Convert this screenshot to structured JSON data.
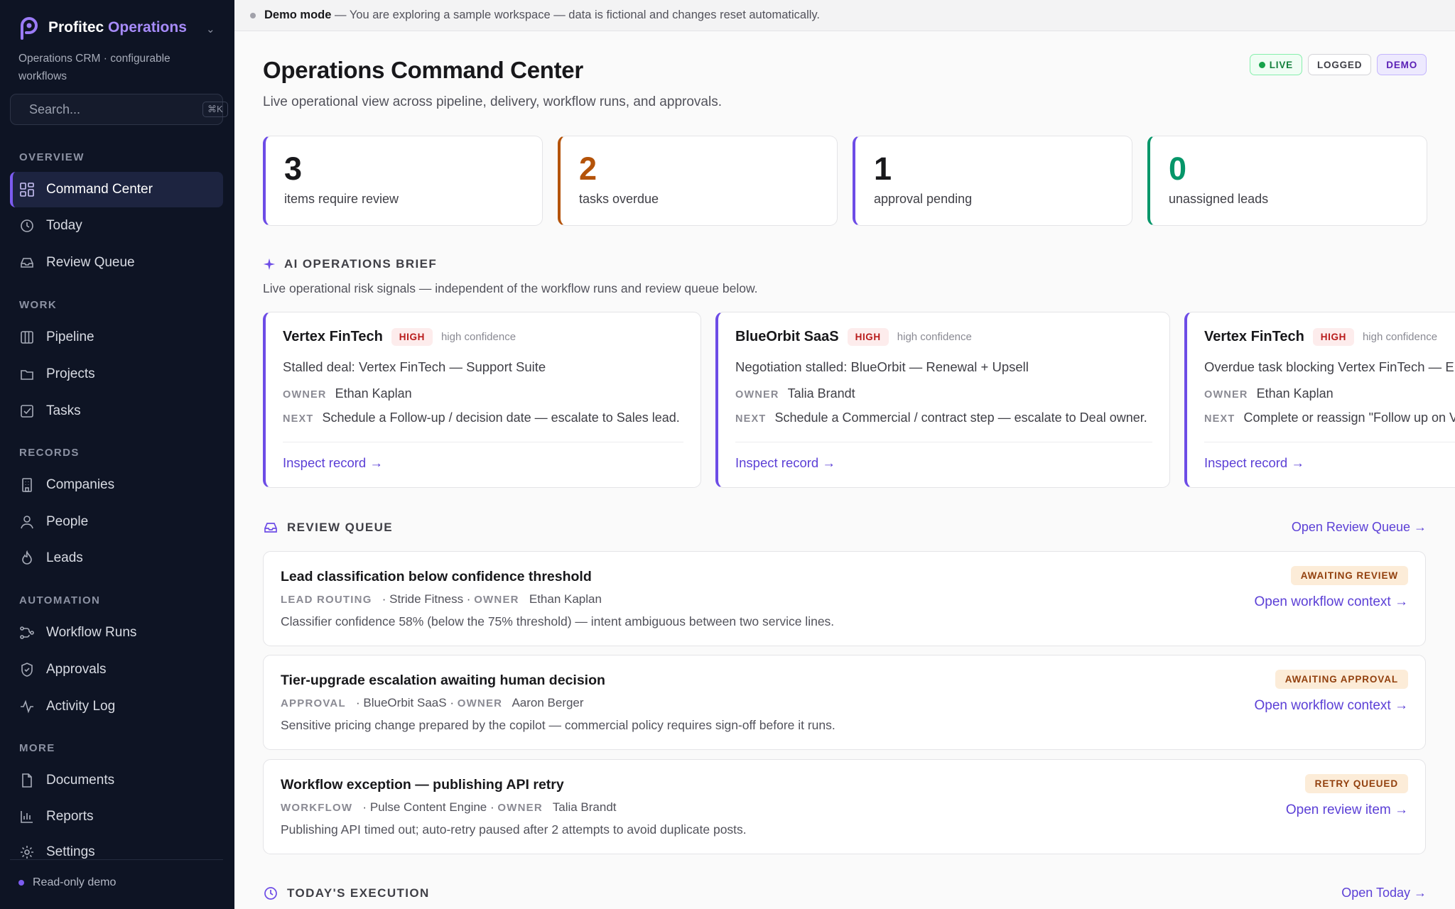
{
  "sidebar": {
    "brand_name": "Profitec",
    "brand_accent": "Operations",
    "subtitle": "Operations CRM · configurable workflows",
    "search_placeholder": "Search...",
    "search_shortcut": "⌘K",
    "sections": {
      "overview": "OVERVIEW",
      "work": "WORK",
      "records": "RECORDS",
      "automation": "AUTOMATION",
      "more": "MORE"
    },
    "items": {
      "command_center": "Command Center",
      "today": "Today",
      "review_queue": "Review Queue",
      "pipeline": "Pipeline",
      "projects": "Projects",
      "tasks": "Tasks",
      "companies": "Companies",
      "people": "People",
      "leads": "Leads",
      "workflow_runs": "Workflow Runs",
      "approvals": "Approvals",
      "activity_log": "Activity Log",
      "documents": "Documents",
      "reports": "Reports",
      "settings": "Settings"
    },
    "footer": "Read-only demo"
  },
  "banner": {
    "label": "Demo mode",
    "text": "— You are exploring a sample workspace — data is fictional and changes reset automatically."
  },
  "header": {
    "title": "Operations Command Center",
    "subtitle": "Live operational view across pipeline, delivery, workflow runs, and approvals.",
    "badges": {
      "live": "LIVE",
      "logged": "LOGGED",
      "demo": "DEMO"
    }
  },
  "stats": [
    {
      "value": "3",
      "label": "items require review",
      "color": "#18181b",
      "accent": "#6d4ce6"
    },
    {
      "value": "2",
      "label": "tasks overdue",
      "color": "#b45309",
      "accent": "#b45309"
    },
    {
      "value": "1",
      "label": "approval pending",
      "color": "#18181b",
      "accent": "#6d4ce6"
    },
    {
      "value": "0",
      "label": "unassigned leads",
      "color": "#059669",
      "accent": "#059669"
    }
  ],
  "brief": {
    "heading": "AI OPERATIONS BRIEF",
    "subtitle": "Live operational risk signals — independent of the workflow runs and review queue below.",
    "owner_key": "OWNER",
    "next_key": "NEXT",
    "cards": [
      {
        "company": "Vertex FinTech",
        "severity": "HIGH",
        "confidence": "high confidence",
        "title": "Stalled deal: Vertex FinTech — Support Suite",
        "owner": "Ethan Kaplan",
        "next": "Schedule a Follow-up / decision date — escalate to Sales lead.",
        "link": "Inspect record →"
      },
      {
        "company": "BlueOrbit SaaS",
        "severity": "HIGH",
        "confidence": "high confidence",
        "title": "Negotiation stalled: BlueOrbit — Renewal + Upsell",
        "owner": "Talia Brandt",
        "next": "Schedule a Commercial / contract step — escalate to Deal owner.",
        "link": "Inspect record →"
      },
      {
        "company": "Vertex FinTech",
        "severity": "HIGH",
        "confidence": "high confidence",
        "title": "Overdue task blocking Vertex FinTech — E",
        "owner": "Ethan Kaplan",
        "next": "Complete or reassign \"Follow up on V",
        "link": "Inspect record →"
      }
    ]
  },
  "review_queue": {
    "heading": "REVIEW QUEUE",
    "open_link": "Open Review Queue →",
    "owner_key": "OWNER",
    "items": [
      {
        "title": "Lead classification below confidence threshold",
        "type": "LEAD ROUTING",
        "company": "Stride Fitness",
        "owner": "Ethan Kaplan",
        "description": "Classifier confidence 58% (below the 75% threshold) — intent ambiguous between two service lines.",
        "status": "AWAITING REVIEW",
        "link": "Open workflow context →"
      },
      {
        "title": "Tier-upgrade escalation awaiting human decision",
        "type": "APPROVAL",
        "company": "BlueOrbit SaaS",
        "owner": "Aaron Berger",
        "description": "Sensitive pricing change prepared by the copilot — commercial policy requires sign-off before it runs.",
        "status": "AWAITING APPROVAL",
        "link": "Open workflow context →"
      },
      {
        "title": "Workflow exception — publishing API retry",
        "type": "WORKFLOW",
        "company": "Pulse Content Engine",
        "owner": "Talia Brandt",
        "description": "Publishing API timed out; auto-retry paused after 2 attempts to avoid duplicate posts.",
        "status": "RETRY QUEUED",
        "link": "Open review item →"
      }
    ]
  },
  "today": {
    "heading": "TODAY'S EXECUTION",
    "open_link": "Open Today →"
  }
}
